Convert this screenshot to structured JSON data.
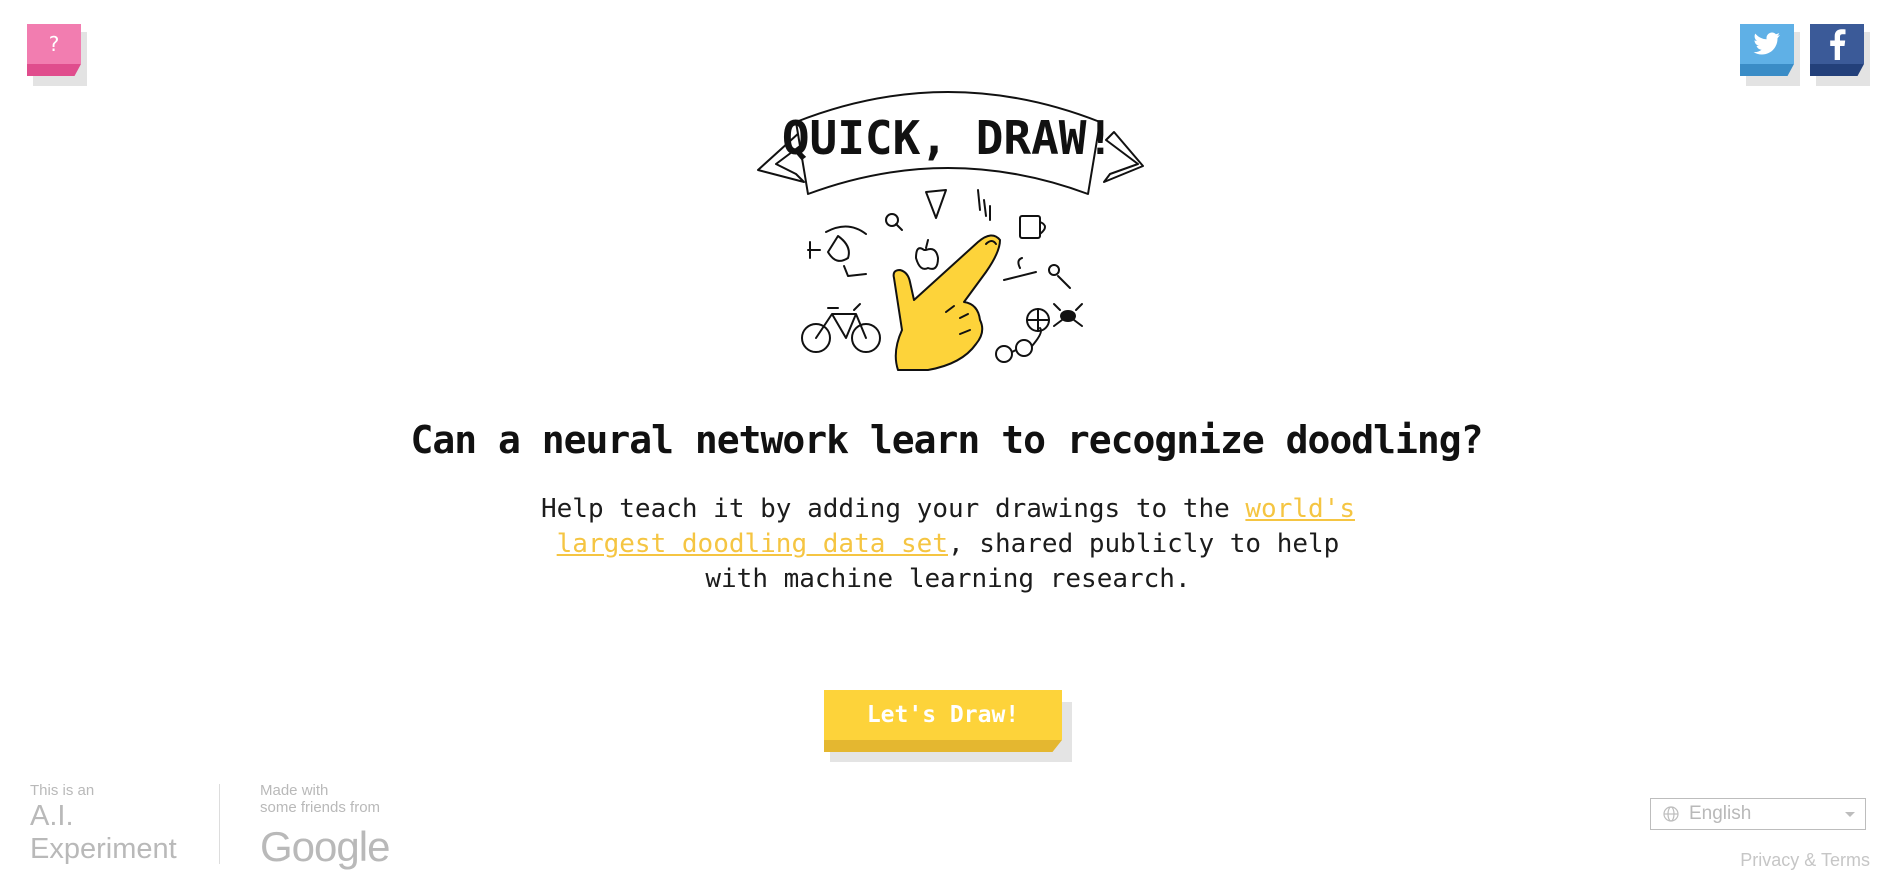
{
  "header": {
    "help_label": "?",
    "twitter_icon": "twitter-bird-icon",
    "facebook_icon": "facebook-f-icon"
  },
  "hero": {
    "banner_title": "QUICK, DRAW!",
    "illustration": "doodles-with-pointing-hand",
    "accent_color": "#fdd33a"
  },
  "main": {
    "headline": "Can a neural network learn to recognize doodling?",
    "description_before": "Help teach it by adding your drawings to the ",
    "description_link": "world's largest doodling data set",
    "description_after": ", shared publicly to help with machine learning research.",
    "cta_label": "Let's Draw!"
  },
  "footer": {
    "ai_small": "This is an",
    "ai_line1": "A.I.",
    "ai_line2": "Experiment",
    "made_with_line1": "Made with",
    "made_with_line2": "some friends from",
    "google_logo": "Google",
    "language_selected": "English",
    "privacy_label": "Privacy & Terms"
  },
  "colors": {
    "help_pink": "#f27db0",
    "twitter_blue": "#5fb0e6",
    "facebook_blue": "#3b5a98",
    "link_yellow": "#f5c542",
    "button_yellow": "#fdd33a"
  }
}
